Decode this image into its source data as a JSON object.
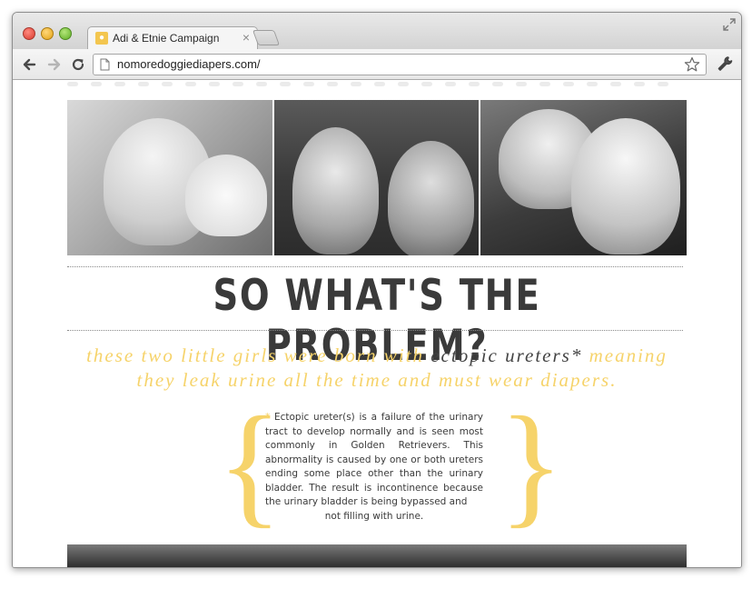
{
  "browser": {
    "tab_title": "Adi & Etnie Campaign",
    "tab_close": "×",
    "url": "nomoredoggiediapers.com/"
  },
  "page": {
    "headline": "SO WHAT'S THE PROBLEM?",
    "tagline_part1": "these two little girls were born with",
    "tagline_emphasis": "ectopic ureters*",
    "tagline_part2": "meaning they leak urine all the time and must wear diapers.",
    "brace_left": "{",
    "brace_right": "}",
    "definition_asterisk": "*",
    "definition_body": "Ectopic ureter(s) is a failure of the urinary tract to develop normally and is seen most commonly in Golden Retrievers. This abnormality is caused by one or both ureters ending some place other than the urinary bladder. The result is incontinence because the urinary bladder is being bypassed and",
    "definition_last": "not filling with urine."
  },
  "icons": {
    "favicon": "paw-icon",
    "back": "back-arrow-icon",
    "forward": "forward-arrow-icon",
    "reload": "reload-icon",
    "page": "page-icon",
    "bookmark": "star-icon",
    "settings": "wrench-icon",
    "fullscreen": "fullscreen-icon"
  },
  "colors": {
    "accent_yellow": "#f6d36a",
    "headline_gray": "#3a3a3a"
  }
}
